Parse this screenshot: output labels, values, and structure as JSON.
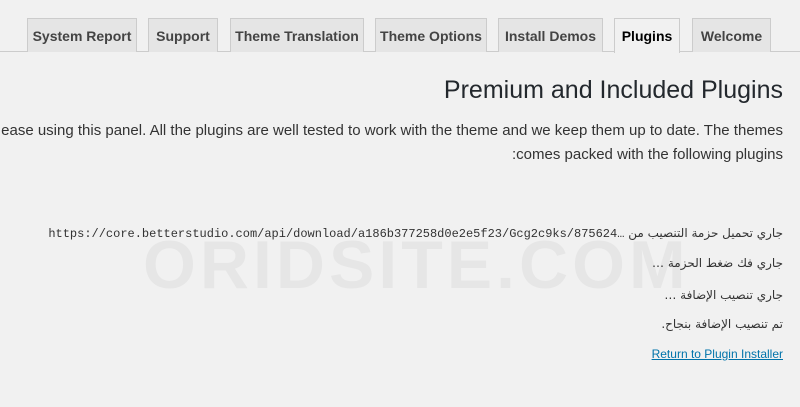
{
  "tabs": [
    {
      "label": "System Report"
    },
    {
      "label": "Support"
    },
    {
      "label": "Theme Translation"
    },
    {
      "label": "Theme Options"
    },
    {
      "label": "Install Demos"
    },
    {
      "label": "Plugins"
    },
    {
      "label": "Welcome"
    }
  ],
  "active_tab": "Plugins",
  "main": {
    "title": "Premium and Included Plugins",
    "description_line1": "ease using this panel. All the plugins are well tested to work with the theme and we keep them up to date. The themes",
    "description_line2": ":comes packed with the following plugins",
    "log": {
      "line1_prefix": "جاري تحميل حزمة التنصيب من",
      "line1_url": "https://core.betterstudio.com/api/download/a186b377258d0e2e5f23/Gcg2c9ks/875624…",
      "line2": "جاري فك ضغط الحزمة …",
      "line3": "جاري تنصيب الإضافة …",
      "line4": "تم تنصيب الإضافة بنجاح."
    },
    "return_link": "Return to Plugin Installer"
  },
  "watermark": "ORIDSITE.COM",
  "colors": {
    "background": "#f1f1f1",
    "tab_background": "#e5e5e5",
    "tab_border": "#cccccc",
    "link": "#0073aa"
  }
}
